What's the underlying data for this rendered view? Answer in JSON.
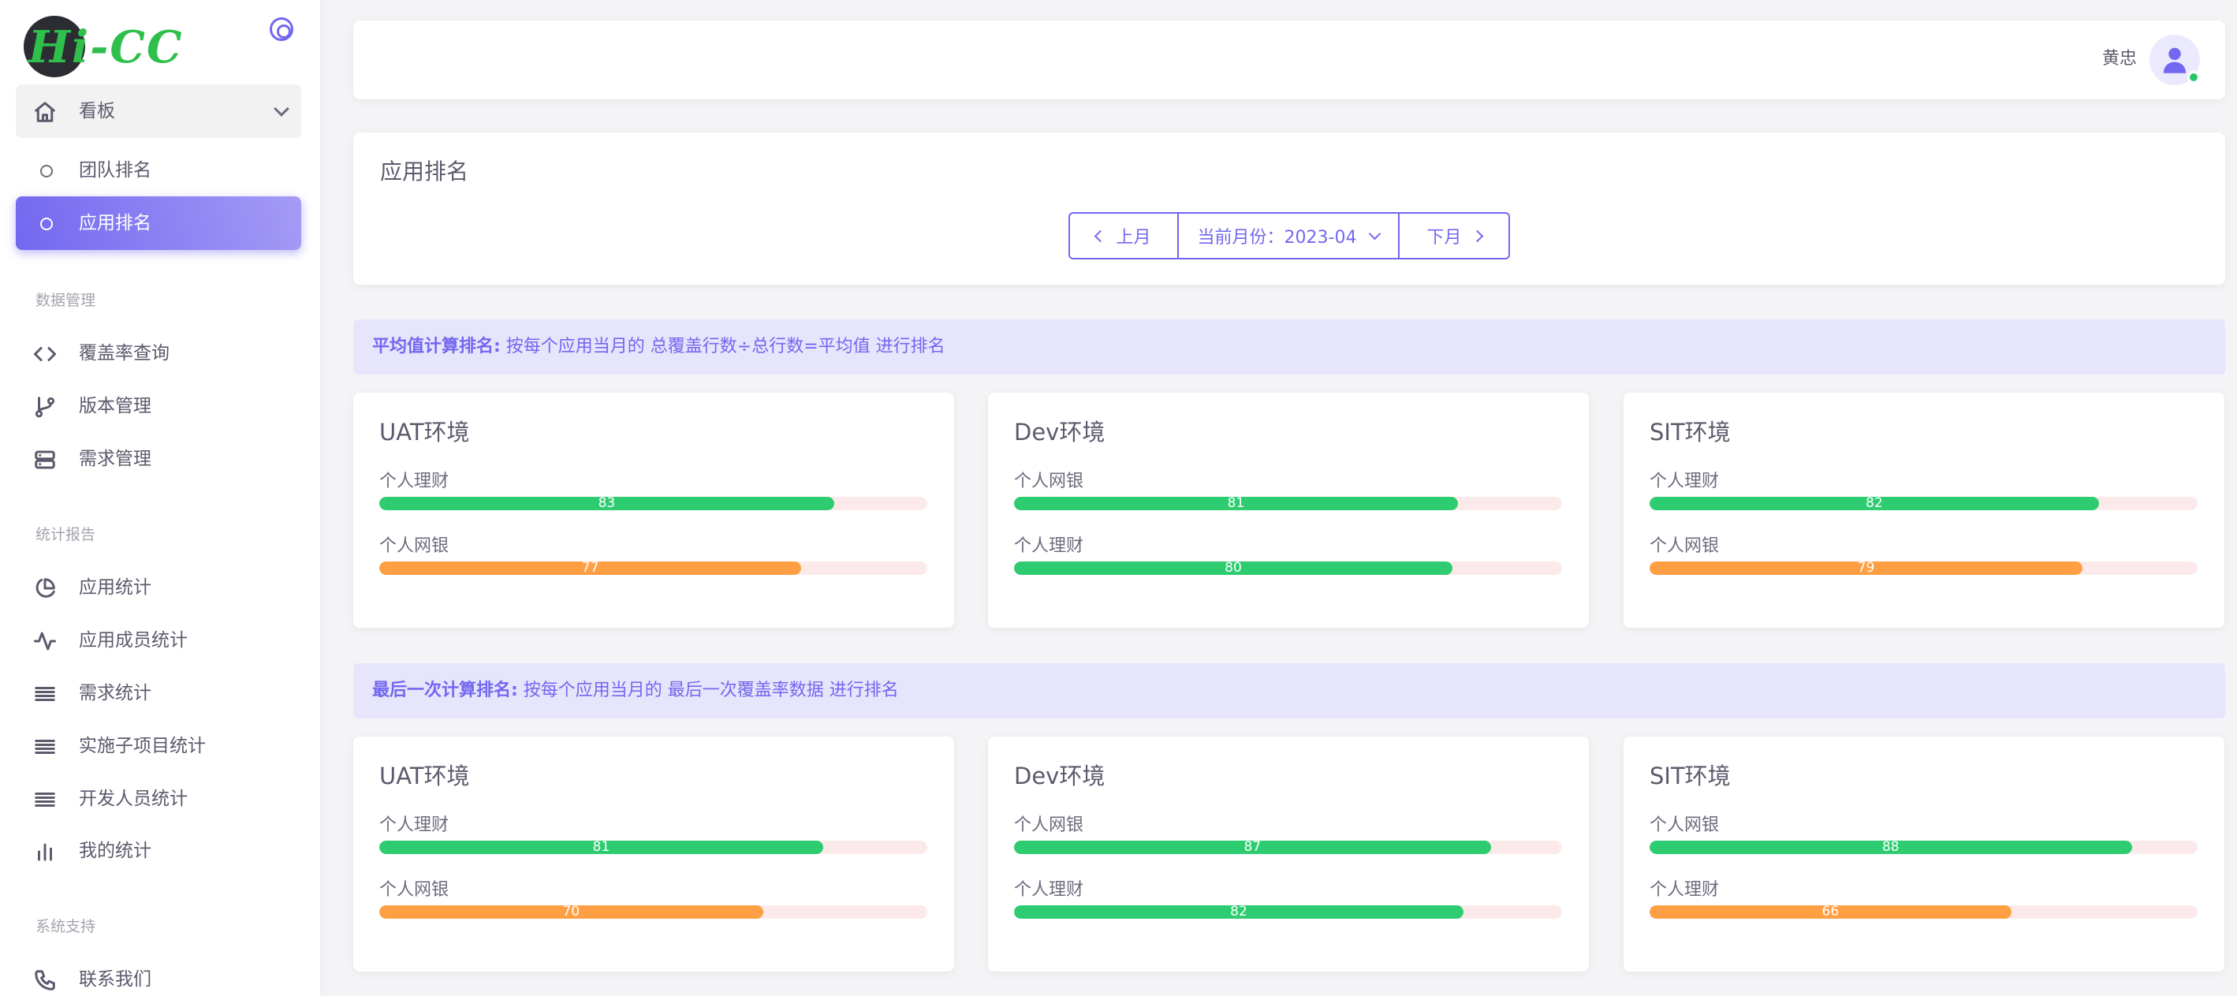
{
  "brand": {
    "logo_text": "Hi-CC"
  },
  "sidebar": {
    "dashboard_label": "看板",
    "dashboard_items": [
      {
        "label": "团队排名"
      },
      {
        "label": "应用排名"
      }
    ],
    "section_data": "数据管理",
    "data_items": [
      {
        "label": "覆盖率查询",
        "icon": "code-icon"
      },
      {
        "label": "版本管理",
        "icon": "git-branch-icon"
      },
      {
        "label": "需求管理",
        "icon": "server-icon"
      }
    ],
    "section_report": "统计报告",
    "report_items": [
      {
        "label": "应用统计",
        "icon": "pie-chart-icon"
      },
      {
        "label": "应用成员统计",
        "icon": "activity-icon"
      },
      {
        "label": "需求统计",
        "icon": "list-icon"
      },
      {
        "label": "实施子项目统计",
        "icon": "list-icon"
      },
      {
        "label": "开发人员统计",
        "icon": "list-icon"
      },
      {
        "label": "我的统计",
        "icon": "bar-chart-icon"
      }
    ],
    "section_support": "系统支持",
    "support_items": [
      {
        "label": "联系我们",
        "icon": "phone-icon"
      }
    ]
  },
  "header": {
    "user_name": "黄忠"
  },
  "ranking": {
    "title": "应用排名",
    "prev_label": "上月",
    "current_month_label": "当前月份：2023-04",
    "next_label": "下月"
  },
  "avg_note": {
    "bold": "平均值计算排名:",
    "text": " 按每个应用当月的 总覆盖行数÷总行数=平均值 进行排名"
  },
  "last_note": {
    "bold": "最后一次计算排名:",
    "text": " 按每个应用当月的 最后一次覆盖率数据 进行排名"
  },
  "avg_envs": [
    {
      "name": "UAT环境",
      "bars": [
        {
          "label": "个人理财",
          "value": 83,
          "color": "green"
        },
        {
          "label": "个人网银",
          "value": 77,
          "color": "orange"
        }
      ]
    },
    {
      "name": "Dev环境",
      "bars": [
        {
          "label": "个人网银",
          "value": 81,
          "color": "green"
        },
        {
          "label": "个人理财",
          "value": 80,
          "color": "green"
        }
      ]
    },
    {
      "name": "SIT环境",
      "bars": [
        {
          "label": "个人理财",
          "value": 82,
          "color": "green"
        },
        {
          "label": "个人网银",
          "value": 79,
          "color": "orange"
        }
      ]
    }
  ],
  "last_envs": [
    {
      "name": "UAT环境",
      "bars": [
        {
          "label": "个人理财",
          "value": 81,
          "color": "green"
        },
        {
          "label": "个人网银",
          "value": 70,
          "color": "orange"
        }
      ]
    },
    {
      "name": "Dev环境",
      "bars": [
        {
          "label": "个人网银",
          "value": 87,
          "color": "green"
        },
        {
          "label": "个人理财",
          "value": 82,
          "color": "green"
        }
      ]
    },
    {
      "name": "SIT环境",
      "bars": [
        {
          "label": "个人网银",
          "value": 88,
          "color": "green"
        },
        {
          "label": "个人理财",
          "value": 66,
          "color": "orange"
        }
      ]
    }
  ],
  "colors": {
    "accent": "#7367f0",
    "green": "#2ecc71",
    "orange": "#ff9f43",
    "track": "#fceaea"
  }
}
